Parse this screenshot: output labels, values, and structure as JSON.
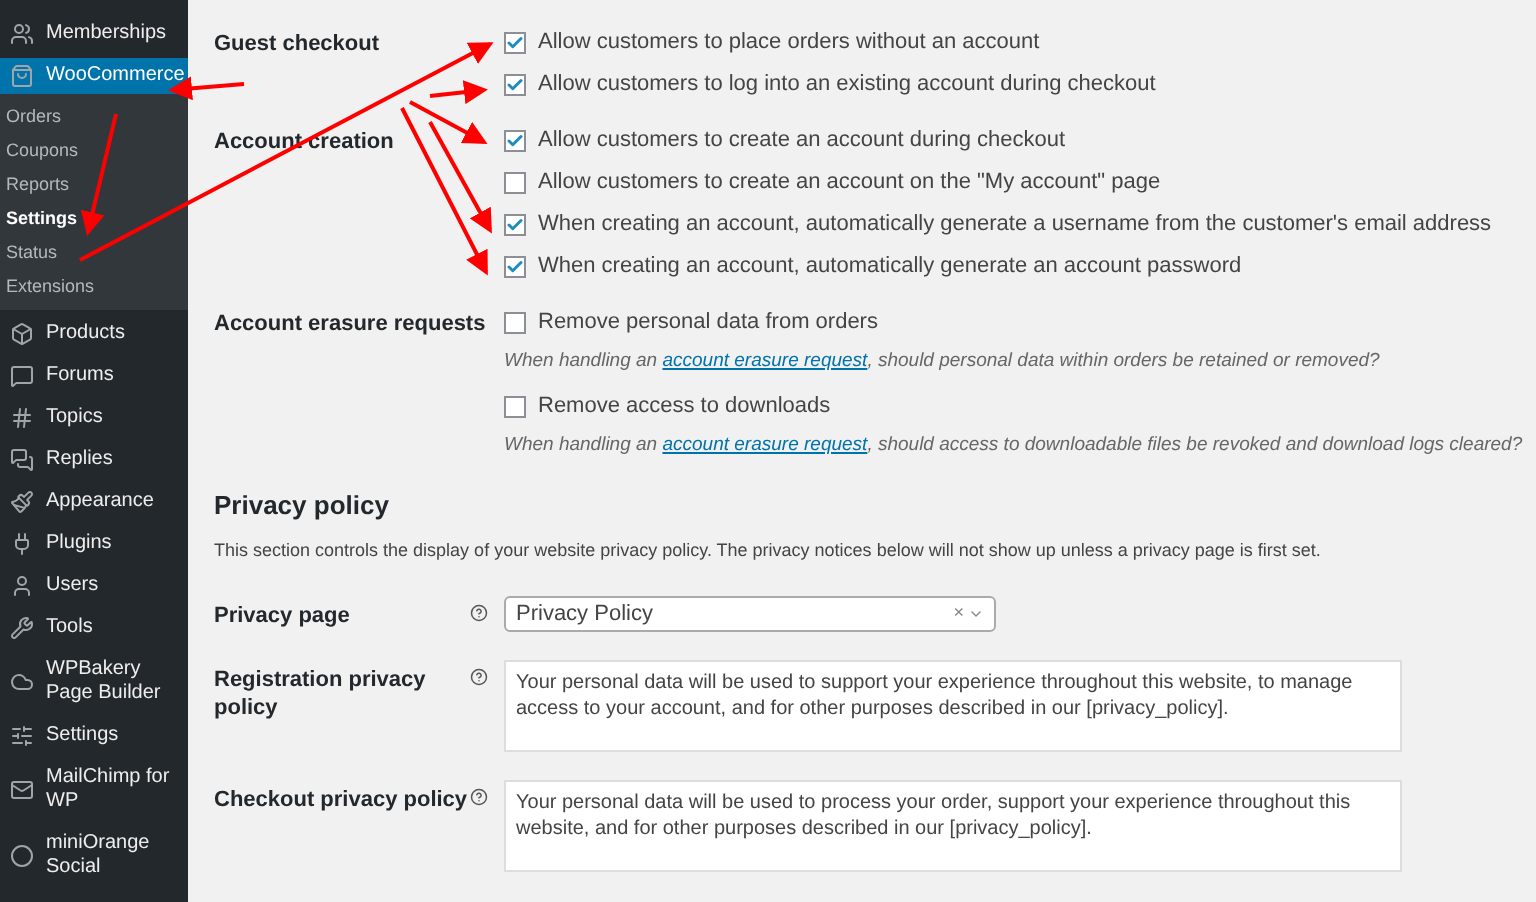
{
  "sidebar": {
    "items": [
      {
        "label": "Memberships",
        "selected": false
      },
      {
        "label": "WooCommerce",
        "selected": true,
        "children": [
          {
            "label": "Orders",
            "selected": false
          },
          {
            "label": "Coupons",
            "selected": false
          },
          {
            "label": "Reports",
            "selected": false
          },
          {
            "label": "Settings",
            "selected": true
          },
          {
            "label": "Status",
            "selected": false
          },
          {
            "label": "Extensions",
            "selected": false
          }
        ]
      },
      {
        "label": "Products",
        "selected": false
      },
      {
        "label": "Forums",
        "selected": false
      },
      {
        "label": "Topics",
        "selected": false
      },
      {
        "label": "Replies",
        "selected": false
      },
      {
        "label": "Appearance",
        "selected": false
      },
      {
        "label": "Plugins",
        "selected": false
      },
      {
        "label": "Users",
        "selected": false
      },
      {
        "label": "Tools",
        "selected": false
      },
      {
        "label": "WPBakery Page Builder",
        "selected": false
      },
      {
        "label": "Settings",
        "selected": false
      },
      {
        "label": "MailChimp for WP",
        "selected": false
      },
      {
        "label": "miniOrange Social",
        "selected": false
      }
    ]
  },
  "settings": [
    {
      "label": "Guest checkout",
      "options": [
        {
          "label": "Allow customers to place orders without an account",
          "checked": true
        },
        {
          "label": "Allow customers to log into an existing account during checkout",
          "checked": true
        }
      ]
    },
    {
      "label": "Account creation",
      "options": [
        {
          "label": "Allow customers to create an account during checkout",
          "checked": true
        },
        {
          "label": "Allow customers to create an account on the \"My account\" page",
          "checked": false
        },
        {
          "label": "When creating an account, automatically generate a username from the customer's email address",
          "checked": true
        },
        {
          "label": "When creating an account, automatically generate an account password",
          "checked": true
        }
      ]
    },
    {
      "label": "Account erasure requests",
      "options": [
        {
          "label": "Remove personal data from orders",
          "checked": false,
          "description": {
            "before": "When handling an",
            "link": "account erasure request",
            "after": ", should personal data within orders be retained or removed?"
          }
        },
        {
          "label": "Remove access to downloads",
          "checked": false,
          "description": {
            "before": "When handling an",
            "link": "account erasure request",
            "after": ", should access to downloadable files be revoked and download logs cleared?"
          }
        }
      ]
    }
  ],
  "privacy": {
    "heading": "Privacy policy",
    "description": "This section controls the display of your website privacy policy. The privacy notices below will not show up unless a privacy page is first set.",
    "fields": [
      {
        "label": "Privacy page",
        "kind": "select",
        "value": "Privacy Policy",
        "clear": "×"
      },
      {
        "label": "Registration privacy policy",
        "kind": "textarea",
        "value": "Your personal data will be used to support your experience throughout this website, to manage access to your account, and for other purposes described in our [privacy_policy]."
      },
      {
        "label": "Checkout privacy policy",
        "kind": "textarea",
        "value": "Your personal data will be used to process your order, support your experience throughout this website, and for other purposes described in our [privacy_policy]."
      }
    ]
  }
}
